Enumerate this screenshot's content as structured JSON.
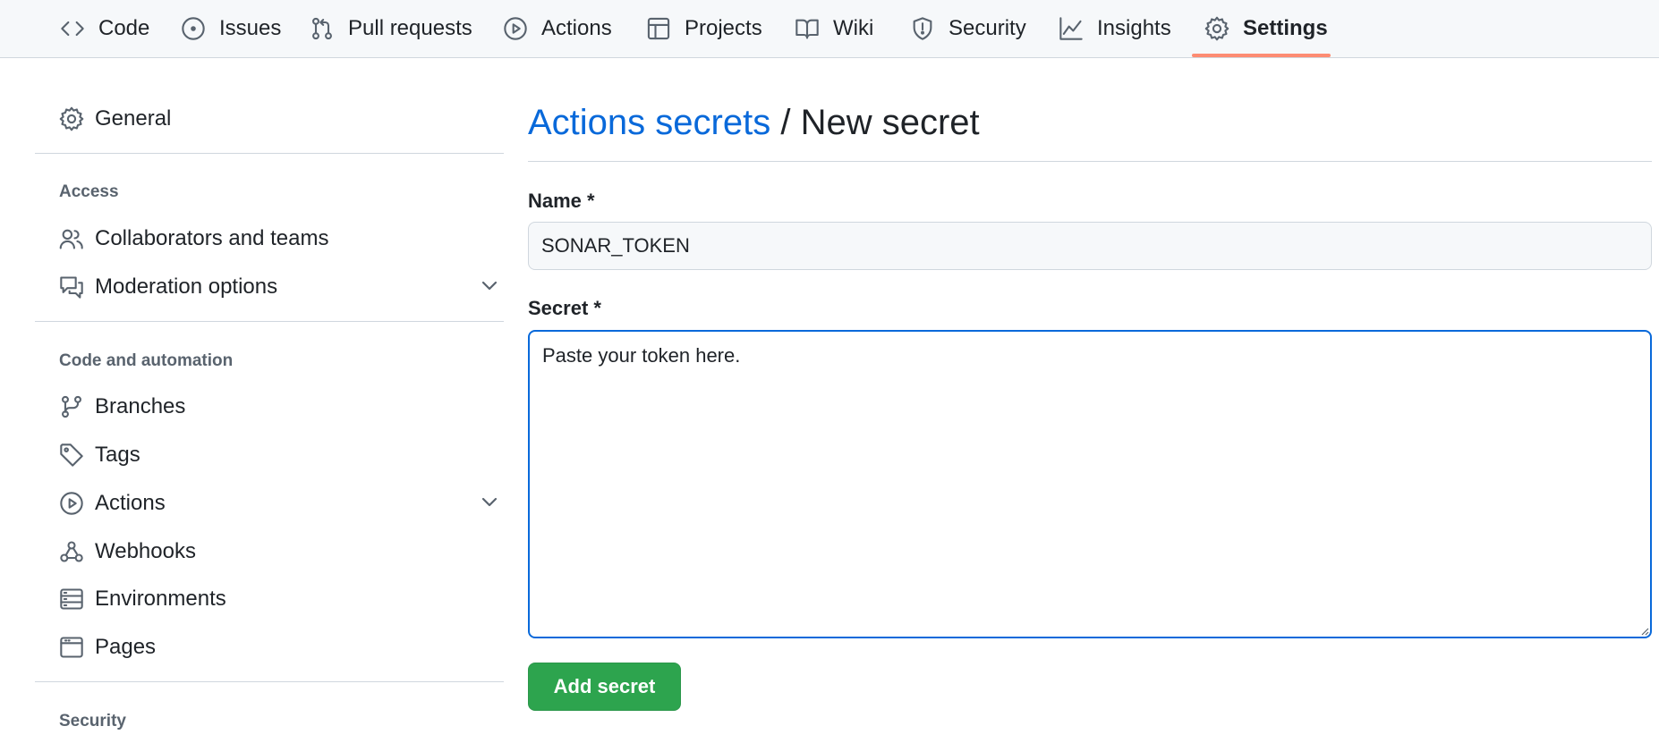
{
  "topnav": {
    "tabs": [
      {
        "label": "Code",
        "icon": "code-icon"
      },
      {
        "label": "Issues",
        "icon": "issue-icon"
      },
      {
        "label": "Pull requests",
        "icon": "pull-request-icon"
      },
      {
        "label": "Actions",
        "icon": "play-icon"
      },
      {
        "label": "Projects",
        "icon": "table-icon"
      },
      {
        "label": "Wiki",
        "icon": "book-icon"
      },
      {
        "label": "Security",
        "icon": "shield-icon"
      },
      {
        "label": "Insights",
        "icon": "graph-icon"
      },
      {
        "label": "Settings",
        "icon": "gear-icon"
      }
    ],
    "active_tab": "Settings",
    "active_color": "#fd8c73"
  },
  "sidebar": {
    "general": "General",
    "sections": [
      {
        "heading": "Access",
        "items": [
          {
            "label": "Collaborators and teams",
            "icon": "people-icon",
            "expandable": false
          },
          {
            "label": "Moderation options",
            "icon": "comment-discussion-icon",
            "expandable": true
          }
        ]
      },
      {
        "heading": "Code and automation",
        "items": [
          {
            "label": "Branches",
            "icon": "git-branch-icon",
            "expandable": false
          },
          {
            "label": "Tags",
            "icon": "tag-icon",
            "expandable": false
          },
          {
            "label": "Actions",
            "icon": "play-icon",
            "expandable": true
          },
          {
            "label": "Webhooks",
            "icon": "webhook-icon",
            "expandable": false
          },
          {
            "label": "Environments",
            "icon": "server-icon",
            "expandable": false
          },
          {
            "label": "Pages",
            "icon": "browser-icon",
            "expandable": false
          }
        ]
      },
      {
        "heading": "Security",
        "items": []
      }
    ]
  },
  "main": {
    "breadcrumb_link": "Actions secrets",
    "breadcrumb_sep": " / ",
    "breadcrumb_current": "New secret",
    "name_label": "Name *",
    "name_value": "SONAR_TOKEN",
    "secret_label": "Secret *",
    "secret_value": "Paste your token here.",
    "submit_label": "Add secret"
  },
  "colors": {
    "link": "#0969da",
    "button": "#2da44e",
    "focus": "#0969da"
  }
}
